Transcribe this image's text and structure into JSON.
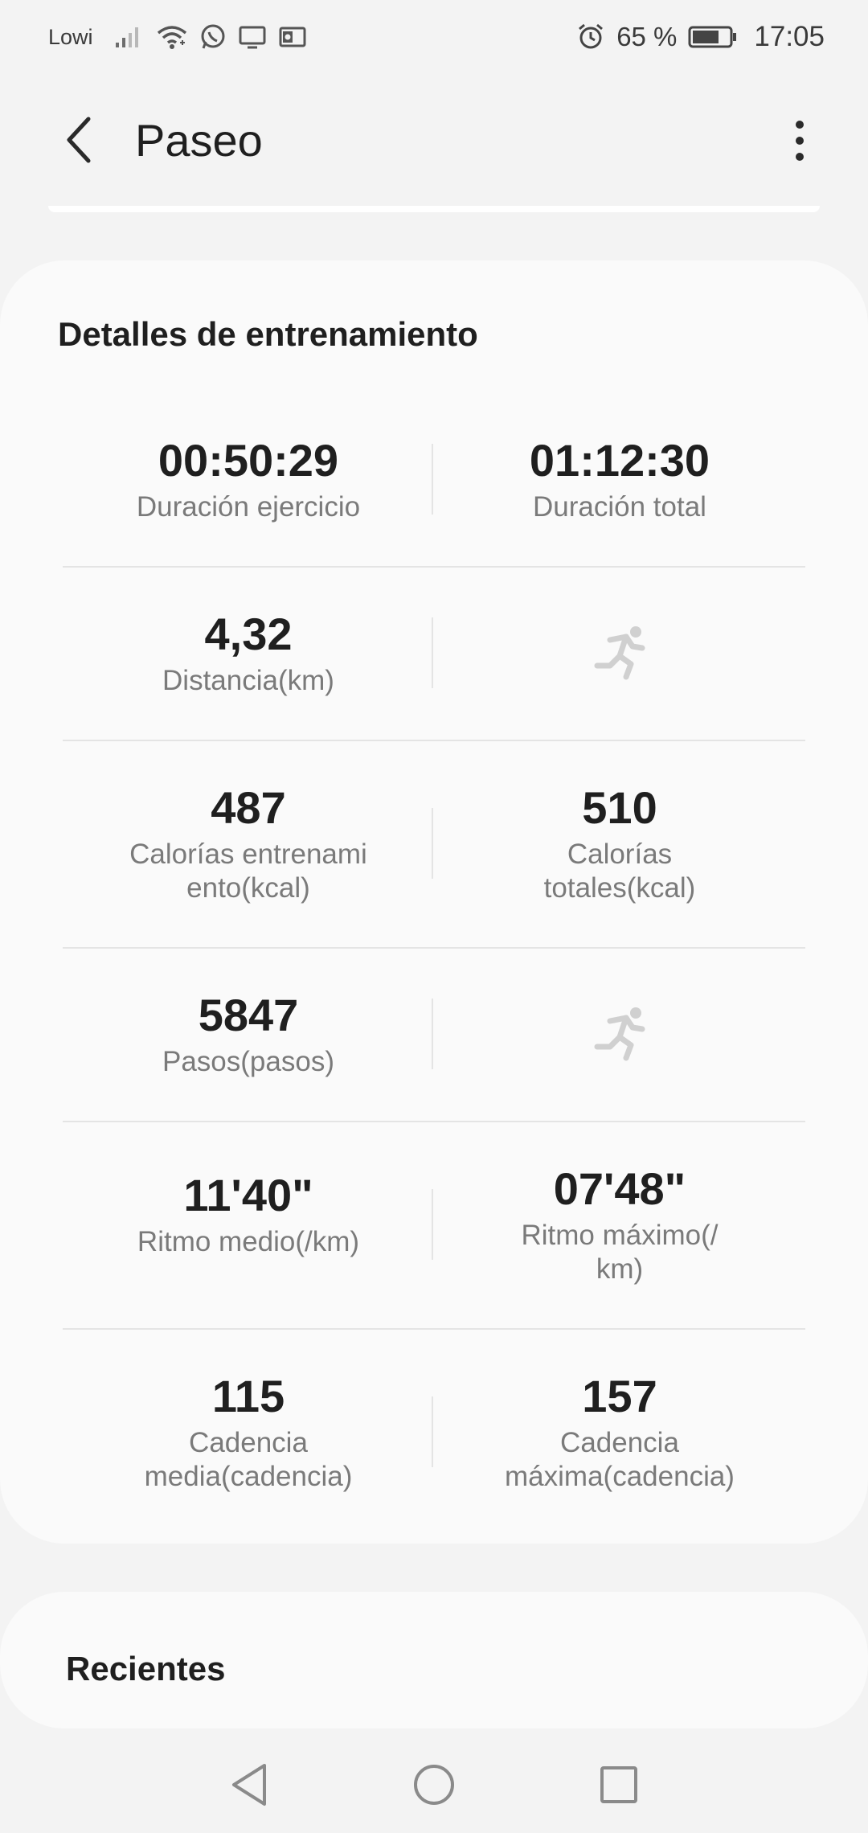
{
  "status_bar": {
    "carrier": "Lowi",
    "battery_pct": "65 %",
    "time": "17:05",
    "icons": [
      "signal-icon",
      "wifi-icon",
      "whatsapp-icon",
      "screen-icon",
      "outlook-icon",
      "alarm-icon",
      "battery-icon"
    ]
  },
  "header": {
    "title": "Paseo"
  },
  "details": {
    "title": "Detalles de entrenamiento",
    "rows": [
      {
        "left": {
          "value": "00:50:29",
          "label": "Duración ejercicio"
        },
        "right": {
          "value": "01:12:30",
          "label": "Duración total"
        }
      },
      {
        "left": {
          "value": "4,32",
          "label": "Distancia(km)"
        },
        "right": {
          "icon": "running-person-icon"
        }
      },
      {
        "left": {
          "value": "487",
          "label": "Calorías entrenami ento(kcal)"
        },
        "right": {
          "value": "510",
          "label": "Calorías totales(kcal)"
        }
      },
      {
        "left": {
          "value": "5847",
          "label": "Pasos(pasos)"
        },
        "right": {
          "icon": "running-person-icon"
        }
      },
      {
        "left": {
          "value": "11'40\"",
          "label": "Ritmo medio(/km)"
        },
        "right": {
          "value": "07'48\"",
          "label": "Ritmo máximo(/ km)"
        }
      },
      {
        "left": {
          "value": "115",
          "label": "Cadencia media(cadencia)"
        },
        "right": {
          "value": "157",
          "label": "Cadencia máxima(cadencia)"
        }
      }
    ]
  },
  "recent": {
    "title": "Recientes"
  },
  "nav": {
    "icons": [
      "back-triangle-icon",
      "home-circle-icon",
      "recents-square-icon"
    ]
  },
  "colors": {
    "background": "#f3f3f3",
    "card": "#fafafa",
    "text": "#1f1f1f",
    "label": "#7a7a7a",
    "divider": "#e4e4e4",
    "icon_muted": "#d0d0d0"
  }
}
